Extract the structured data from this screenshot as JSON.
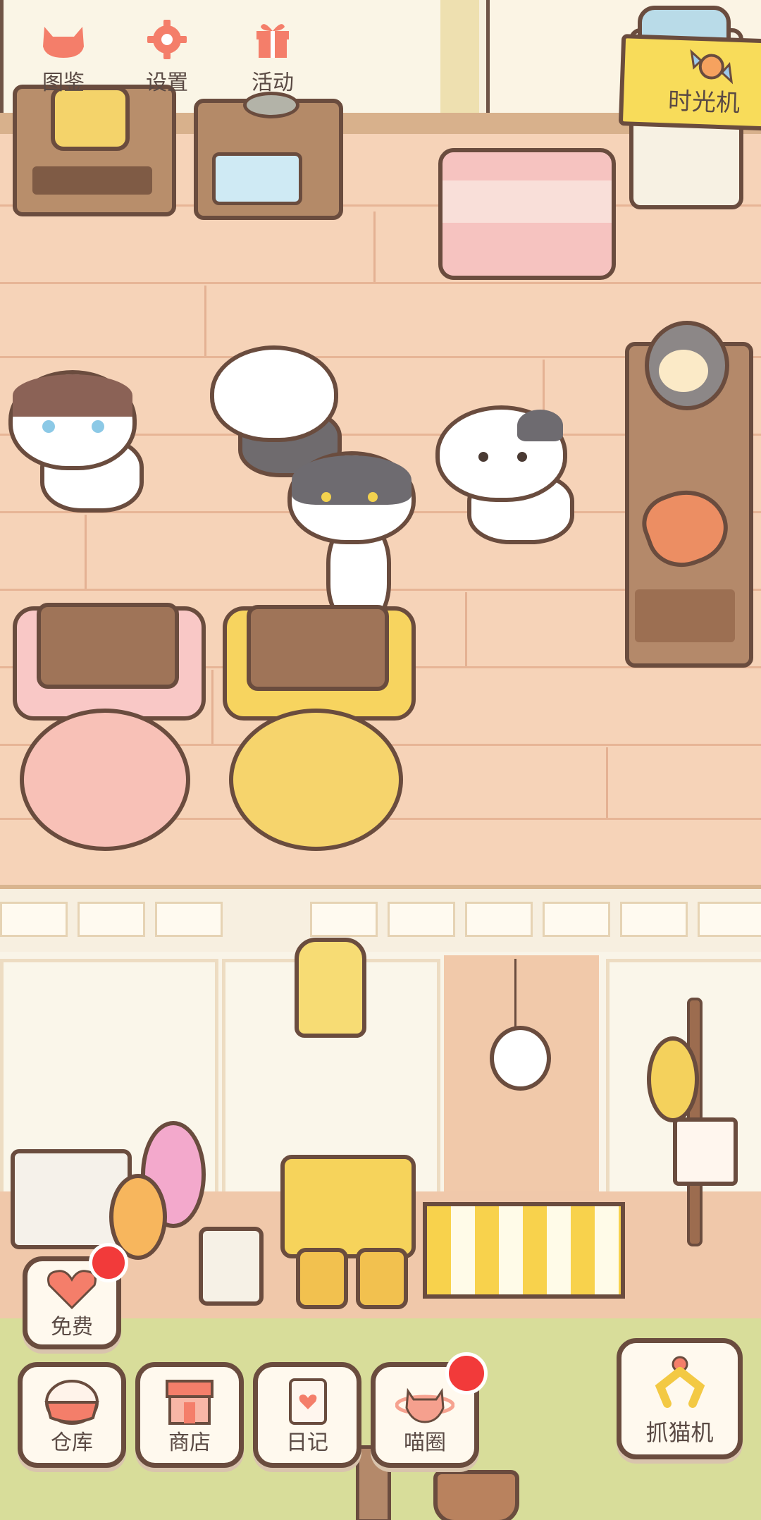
{
  "top_menu": {
    "collection_label": "图鉴",
    "settings_label": "设置",
    "events_label": "活动"
  },
  "time_machine": {
    "label": "时光机"
  },
  "free_button": {
    "label": "免费"
  },
  "bottom_nav": {
    "warehouse_label": "仓库",
    "shop_label": "商店",
    "diary_label": "日记",
    "cat_circle_label": "喵圈"
  },
  "claw_machine": {
    "label": "抓猫机"
  },
  "colors": {
    "accent_orange": "#f47e6a",
    "badge_red": "#f23a3a",
    "banner_yellow": "#f8dc5a",
    "outline_brown": "#6a4c3e"
  },
  "icons": [
    "cat-head-icon",
    "gear-icon",
    "gift-icon",
    "heart-icon",
    "basket-icon",
    "shop-awning-icon",
    "notebook-heart-icon",
    "planet-cat-icon",
    "claw-icon",
    "candy-icon"
  ]
}
